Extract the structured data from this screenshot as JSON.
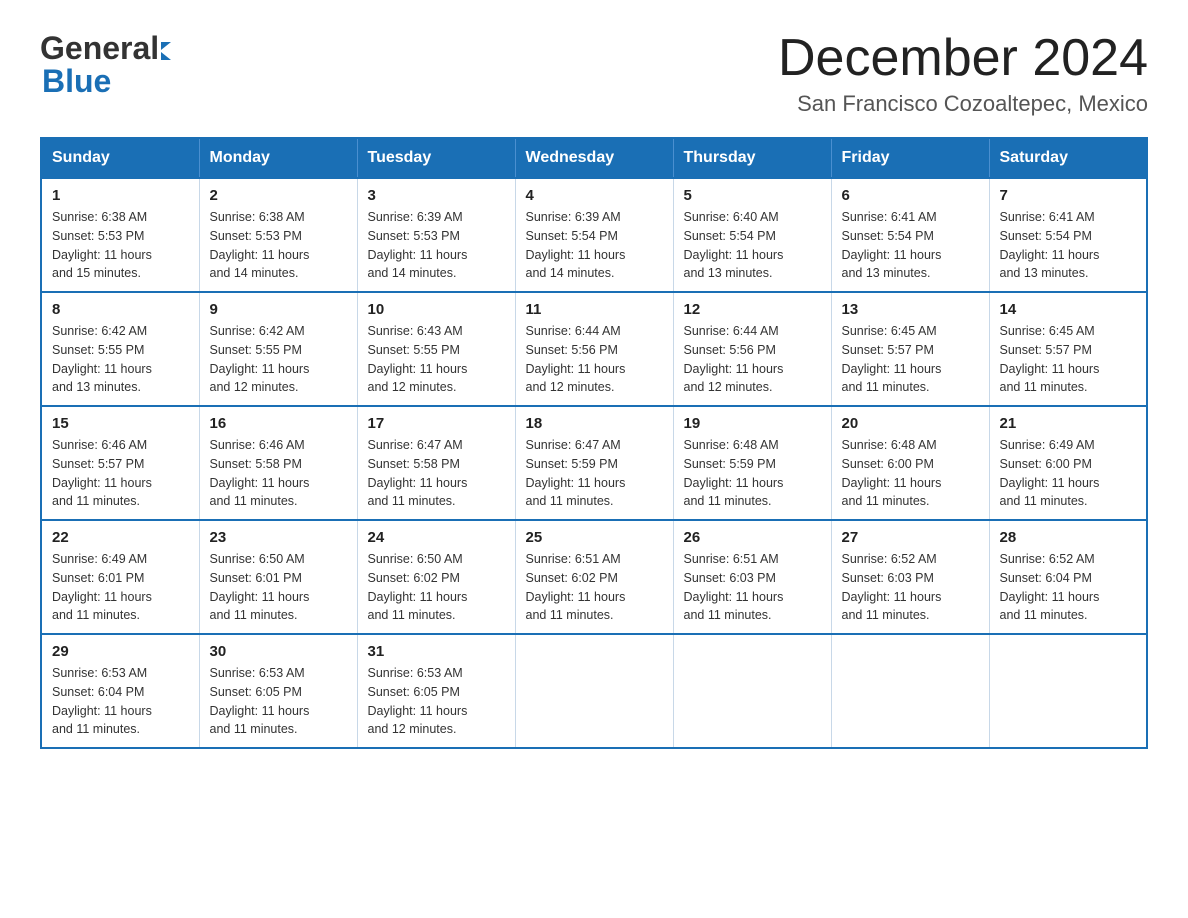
{
  "header": {
    "month_title": "December 2024",
    "location": "San Francisco Cozoaltepec, Mexico",
    "logo_general": "General",
    "logo_blue": "Blue"
  },
  "days_of_week": [
    "Sunday",
    "Monday",
    "Tuesday",
    "Wednesday",
    "Thursday",
    "Friday",
    "Saturday"
  ],
  "weeks": [
    [
      {
        "day": "1",
        "sunrise": "6:38 AM",
        "sunset": "5:53 PM",
        "daylight": "11 hours and 15 minutes."
      },
      {
        "day": "2",
        "sunrise": "6:38 AM",
        "sunset": "5:53 PM",
        "daylight": "11 hours and 14 minutes."
      },
      {
        "day": "3",
        "sunrise": "6:39 AM",
        "sunset": "5:53 PM",
        "daylight": "11 hours and 14 minutes."
      },
      {
        "day": "4",
        "sunrise": "6:39 AM",
        "sunset": "5:54 PM",
        "daylight": "11 hours and 14 minutes."
      },
      {
        "day": "5",
        "sunrise": "6:40 AM",
        "sunset": "5:54 PM",
        "daylight": "11 hours and 13 minutes."
      },
      {
        "day": "6",
        "sunrise": "6:41 AM",
        "sunset": "5:54 PM",
        "daylight": "11 hours and 13 minutes."
      },
      {
        "day": "7",
        "sunrise": "6:41 AM",
        "sunset": "5:54 PM",
        "daylight": "11 hours and 13 minutes."
      }
    ],
    [
      {
        "day": "8",
        "sunrise": "6:42 AM",
        "sunset": "5:55 PM",
        "daylight": "11 hours and 13 minutes."
      },
      {
        "day": "9",
        "sunrise": "6:42 AM",
        "sunset": "5:55 PM",
        "daylight": "11 hours and 12 minutes."
      },
      {
        "day": "10",
        "sunrise": "6:43 AM",
        "sunset": "5:55 PM",
        "daylight": "11 hours and 12 minutes."
      },
      {
        "day": "11",
        "sunrise": "6:44 AM",
        "sunset": "5:56 PM",
        "daylight": "11 hours and 12 minutes."
      },
      {
        "day": "12",
        "sunrise": "6:44 AM",
        "sunset": "5:56 PM",
        "daylight": "11 hours and 12 minutes."
      },
      {
        "day": "13",
        "sunrise": "6:45 AM",
        "sunset": "5:57 PM",
        "daylight": "11 hours and 11 minutes."
      },
      {
        "day": "14",
        "sunrise": "6:45 AM",
        "sunset": "5:57 PM",
        "daylight": "11 hours and 11 minutes."
      }
    ],
    [
      {
        "day": "15",
        "sunrise": "6:46 AM",
        "sunset": "5:57 PM",
        "daylight": "11 hours and 11 minutes."
      },
      {
        "day": "16",
        "sunrise": "6:46 AM",
        "sunset": "5:58 PM",
        "daylight": "11 hours and 11 minutes."
      },
      {
        "day": "17",
        "sunrise": "6:47 AM",
        "sunset": "5:58 PM",
        "daylight": "11 hours and 11 minutes."
      },
      {
        "day": "18",
        "sunrise": "6:47 AM",
        "sunset": "5:59 PM",
        "daylight": "11 hours and 11 minutes."
      },
      {
        "day": "19",
        "sunrise": "6:48 AM",
        "sunset": "5:59 PM",
        "daylight": "11 hours and 11 minutes."
      },
      {
        "day": "20",
        "sunrise": "6:48 AM",
        "sunset": "6:00 PM",
        "daylight": "11 hours and 11 minutes."
      },
      {
        "day": "21",
        "sunrise": "6:49 AM",
        "sunset": "6:00 PM",
        "daylight": "11 hours and 11 minutes."
      }
    ],
    [
      {
        "day": "22",
        "sunrise": "6:49 AM",
        "sunset": "6:01 PM",
        "daylight": "11 hours and 11 minutes."
      },
      {
        "day": "23",
        "sunrise": "6:50 AM",
        "sunset": "6:01 PM",
        "daylight": "11 hours and 11 minutes."
      },
      {
        "day": "24",
        "sunrise": "6:50 AM",
        "sunset": "6:02 PM",
        "daylight": "11 hours and 11 minutes."
      },
      {
        "day": "25",
        "sunrise": "6:51 AM",
        "sunset": "6:02 PM",
        "daylight": "11 hours and 11 minutes."
      },
      {
        "day": "26",
        "sunrise": "6:51 AM",
        "sunset": "6:03 PM",
        "daylight": "11 hours and 11 minutes."
      },
      {
        "day": "27",
        "sunrise": "6:52 AM",
        "sunset": "6:03 PM",
        "daylight": "11 hours and 11 minutes."
      },
      {
        "day": "28",
        "sunrise": "6:52 AM",
        "sunset": "6:04 PM",
        "daylight": "11 hours and 11 minutes."
      }
    ],
    [
      {
        "day": "29",
        "sunrise": "6:53 AM",
        "sunset": "6:04 PM",
        "daylight": "11 hours and 11 minutes."
      },
      {
        "day": "30",
        "sunrise": "6:53 AM",
        "sunset": "6:05 PM",
        "daylight": "11 hours and 11 minutes."
      },
      {
        "day": "31",
        "sunrise": "6:53 AM",
        "sunset": "6:05 PM",
        "daylight": "11 hours and 12 minutes."
      },
      null,
      null,
      null,
      null
    ]
  ],
  "labels": {
    "sunrise": "Sunrise:",
    "sunset": "Sunset:",
    "daylight": "Daylight:"
  },
  "colors": {
    "header_bg": "#1a6fb5",
    "border": "#1a6fb5",
    "header_text": "#ffffff"
  }
}
